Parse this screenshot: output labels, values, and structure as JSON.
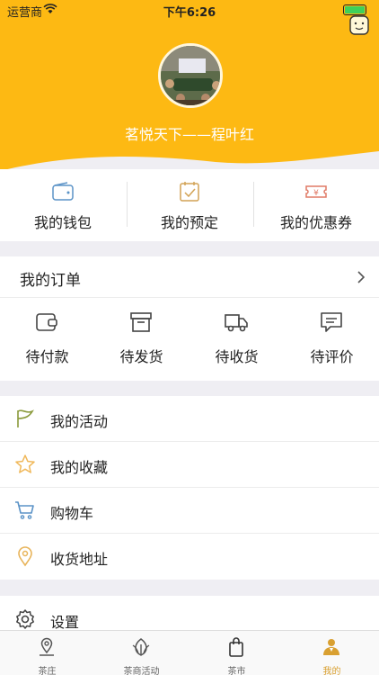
{
  "status_bar": {
    "carrier": "运营商",
    "time": "下午6:26"
  },
  "profile": {
    "nickname": "茗悦天下——程叶红"
  },
  "wallet_row": [
    {
      "label": "我的钱包",
      "icon": "wallet-icon"
    },
    {
      "label": "我的预定",
      "icon": "calendar-check-icon"
    },
    {
      "label": "我的优惠券",
      "icon": "coupon-icon"
    }
  ],
  "orders": {
    "title": "我的订单",
    "items": [
      {
        "label": "待付款",
        "icon": "wallet-outline-icon"
      },
      {
        "label": "待发货",
        "icon": "box-icon"
      },
      {
        "label": "待收货",
        "icon": "truck-icon"
      },
      {
        "label": "待评价",
        "icon": "comment-icon"
      }
    ]
  },
  "menu": [
    {
      "label": "我的活动",
      "icon": "flag-icon"
    },
    {
      "label": "我的收藏",
      "icon": "star-icon"
    },
    {
      "label": "购物车",
      "icon": "cart-icon"
    },
    {
      "label": "收货地址",
      "icon": "location-pin-icon"
    }
  ],
  "settings": {
    "label": "设置",
    "icon": "gear-icon"
  },
  "tabbar": [
    {
      "label": "茶庄",
      "icon": "map-pin-icon"
    },
    {
      "label": "茶商活动",
      "icon": "leaf-icon"
    },
    {
      "label": "茶市",
      "icon": "shopping-bag-icon"
    },
    {
      "label": "我的",
      "icon": "user-icon",
      "active": true
    }
  ],
  "colors": {
    "header": "#fdb913",
    "accent": "#d9a031",
    "wallet_icon": "#5b93c7",
    "calendar_icon": "#d2a255",
    "coupon_icon": "#e07a66",
    "flag_icon": "#8a9a3a",
    "star_icon": "#f0b85a",
    "cart_icon": "#5b93c7",
    "pin_icon": "#e8b45a"
  }
}
